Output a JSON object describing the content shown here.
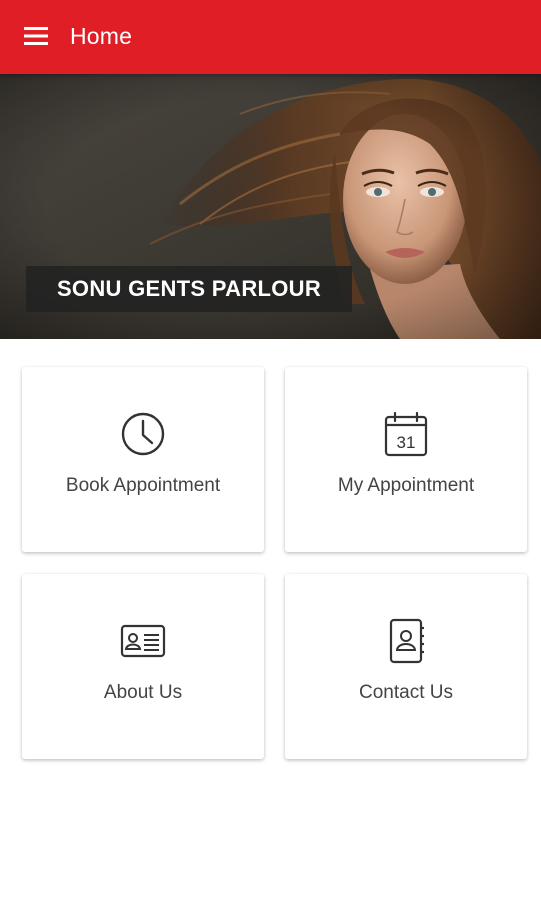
{
  "app_bar": {
    "title": "Home",
    "menu_icon": "hamburger-menu-icon",
    "color": "#e01e26"
  },
  "banner": {
    "business_name": "SONU GENTS PARLOUR"
  },
  "menu_cards": [
    {
      "label": "Book Appointment",
      "icon": "clock-icon"
    },
    {
      "label": "My Appointment",
      "icon": "calendar-icon",
      "icon_text": "31"
    },
    {
      "label": "About Us",
      "icon": "id-card-icon"
    },
    {
      "label": "Contact Us",
      "icon": "address-book-icon"
    }
  ]
}
